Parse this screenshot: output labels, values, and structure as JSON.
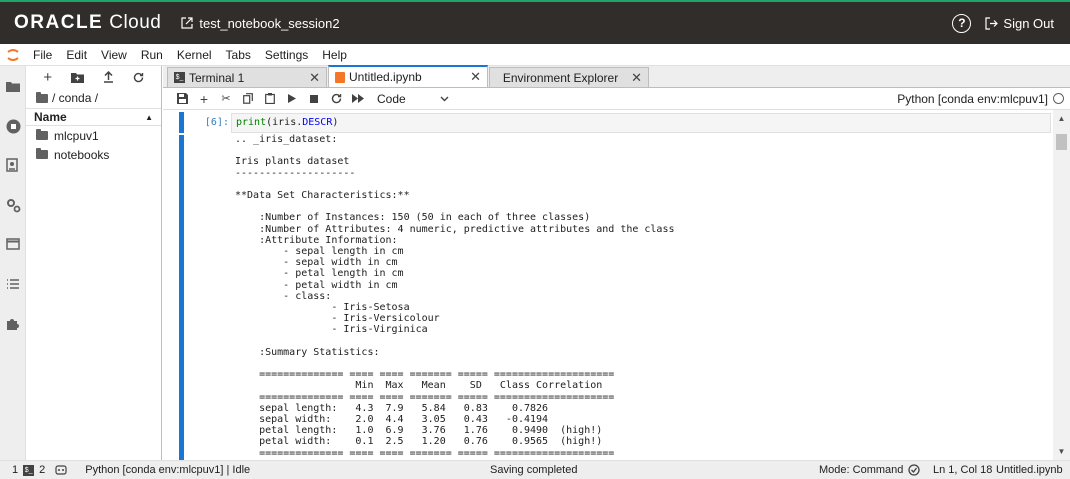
{
  "topbar": {
    "brand": "ORACLE",
    "brand_suffix": "Cloud",
    "session_name": "test_notebook_session2",
    "help_label": "?",
    "signout_label": "Sign Out"
  },
  "menu": [
    "File",
    "Edit",
    "View",
    "Run",
    "Kernel",
    "Tabs",
    "Settings",
    "Help"
  ],
  "filebrowser": {
    "path": "/ conda /",
    "column_header": "Name",
    "items": [
      {
        "name": "mlcpuv1"
      },
      {
        "name": "notebooks"
      }
    ]
  },
  "tabs": [
    {
      "label": "Terminal 1",
      "icon": "terminal-icon"
    },
    {
      "label": "Untitled.ipynb",
      "icon": "notebook-icon",
      "active": true
    },
    {
      "label": "Environment Explorer",
      "icon": ""
    }
  ],
  "notebook_toolbar": {
    "cell_type": "Code",
    "kernel_name": "Python [conda env:mlcpuv1]"
  },
  "cell": {
    "prompt": "[6]:",
    "code_fn": "print",
    "code_arg_a": "(iris.",
    "code_arg_b": "DESCR",
    "code_arg_c": ")",
    "output": ".. _iris_dataset:\n\nIris plants dataset\n--------------------\n\n**Data Set Characteristics:**\n\n    :Number of Instances: 150 (50 in each of three classes)\n    :Number of Attributes: 4 numeric, predictive attributes and the class\n    :Attribute Information:\n        - sepal length in cm\n        - sepal width in cm\n        - petal length in cm\n        - petal width in cm\n        - class:\n                - Iris-Setosa\n                - Iris-Versicolour\n                - Iris-Virginica\n\n    :Summary Statistics:\n\n    ============== ==== ==== ======= ===== ====================\n                    Min  Max   Mean    SD   Class Correlation\n    ============== ==== ==== ======= ===== ====================\n    sepal length:   4.3  7.9   5.84   0.83    0.7826\n    sepal width:    2.0  4.4   3.05   0.43   -0.4194\n    petal length:   1.0  6.9   3.76   1.76    0.9490  (high!)\n    petal width:    0.1  2.5   1.20   0.76    0.9565  (high!)\n    ============== ==== ==== ======= ===== ===================="
  },
  "statusbar": {
    "count_a": "1",
    "terminal_badge": "$_",
    "count_b": "2",
    "kernel_status": "Python [conda env:mlcpuv1] | Idle",
    "saving": "Saving completed",
    "mode": "Mode: Command",
    "position": "Ln 1, Col 18",
    "filename": "Untitled.ipynb"
  }
}
